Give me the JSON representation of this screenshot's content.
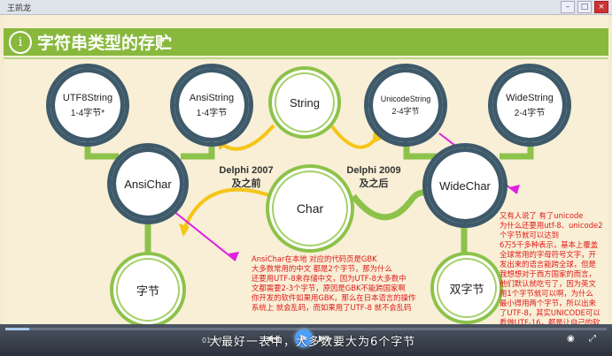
{
  "window": {
    "title": "王凯龙"
  },
  "slide": {
    "title": "字符串类型的存贮",
    "info_icon": "i",
    "nodes": {
      "utf8": {
        "line1": "UTF8String",
        "line2": "1-4字节*"
      },
      "ansistring": {
        "line1": "AnsiString",
        "line2": "1-4字节"
      },
      "string": {
        "line1": "String"
      },
      "unicodestring": {
        "line1": "UnicodeString",
        "line2": "2-4字节"
      },
      "widestring": {
        "line1": "WideString",
        "line2": "2-4字节"
      },
      "ansichar": {
        "line1": "AnsiChar"
      },
      "char": {
        "line1": "Char"
      },
      "widechar": {
        "line1": "WideChar"
      },
      "byte": {
        "line1": "字节"
      },
      "doublebyte": {
        "line1": "双字节"
      }
    },
    "labels": {
      "delphi2007_a": "Delphi  2007",
      "delphi2007_b": "及之前",
      "delphi2009_a": "Delphi  2009",
      "delphi2009_b": "及之后"
    },
    "notes": {
      "left": [
        "AnsiChar在本地  对应的代码页是GBK",
        "大多数常用的中文 都是2个字节，那为什么",
        "还要用UTF-8来存储中文，因为UTF-8大多数中",
        "文都需要2-3个字节，原因是GBK不能跨国家啊",
        "你开发的软件如果用GBK，那么在日本语言的操作",
        "系统上 就会乱码，而如果用了UTF-8 就不会乱码"
      ],
      "right": [
        "又有人说了  有了unicode",
        "为什么还要用utf-8、unicode2",
        "个字节就可以达到",
        "6万5千多种表示，基本上覆盖",
        "全球常用的字母符号文字，开",
        "发出来的语言能跨全球，但是",
        "我想想对于西方国家的而言，",
        "他们默认就吃亏了，因为英文",
        "用1个字节就可以啊，为什么",
        "最小得用两个字节，所以出来",
        "了UTF-8，其实UNICODE可以",
        "看做UTF-16，都是让自己的软"
      ]
    },
    "colors": {
      "green": "#8dc24a",
      "dark": "#3e5a6a",
      "arrow": "#f5c518",
      "pointer": "#e020e0",
      "note": "#e01818"
    }
  },
  "player": {
    "time": "01:07",
    "subtitle": "大最好一表中，大多数要大为6个字节",
    "progress": 0.04
  }
}
